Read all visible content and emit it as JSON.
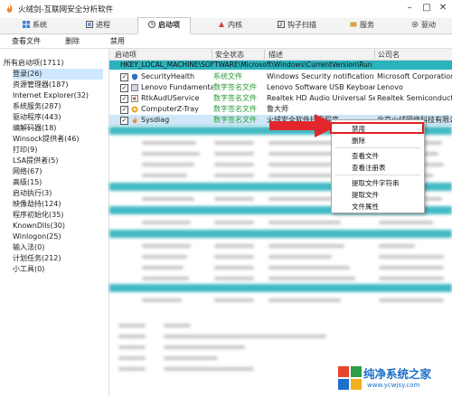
{
  "title": "火绒剑-互联网安全分析软件",
  "tabs": [
    {
      "label": "系统"
    },
    {
      "label": "进程"
    },
    {
      "label": "启动项"
    },
    {
      "label": "内核"
    },
    {
      "label": "钩子扫描"
    },
    {
      "label": "服务"
    },
    {
      "label": "驱动"
    }
  ],
  "toolbar": {
    "view_file": "查看文件",
    "delete": "删除",
    "disable": "禁用"
  },
  "sidebar": {
    "root": "所有启动项(1711)",
    "items": [
      "登录(26)",
      "资源管理器(187)",
      "Internet Explorer(32)",
      "系统服务(287)",
      "驱动程序(443)",
      "编解码器(18)",
      "Winsock提供者(46)",
      "打印(9)",
      "LSA提供者(5)",
      "网络(67)",
      "高级(15)",
      "启动执行(3)",
      "映像劫持(124)",
      "程序初始化(35)",
      "KnownDlls(30)",
      "Winlogon(25)",
      "输入法(0)",
      "计划任务(212)",
      "小工具(0)"
    ]
  },
  "columns": {
    "name": "启动项",
    "status": "安全状态",
    "desc": "描述",
    "company": "公司名"
  },
  "reg_path": "HKEY_LOCAL_MACHINE\\SOFTWARE\\Microsoft\\Windows\\CurrentVersion\\Run",
  "rows": [
    {
      "name": "SecurityHealth",
      "status": "系统文件",
      "desc": "Windows Security notification i...",
      "company": "Microsoft Corporation"
    },
    {
      "name": "Lenovo Fundamental ...",
      "status": "数字签名文件",
      "desc": "Lenovo Software USB Keyboard",
      "company": "Lenovo"
    },
    {
      "name": "RtkAudUService",
      "status": "数字签名文件",
      "desc": "Realtek HD Audio Universal Ser...",
      "company": "Realtek Semiconductor"
    },
    {
      "name": "ComputerZ-Tray",
      "status": "数字签名文件",
      "desc": "鲁大师",
      "company": ""
    },
    {
      "name": "Sysdiag",
      "status": "数字签名文件",
      "desc": "火绒安全软件托盘程序",
      "company": "北京火绒网络科技有限公司"
    }
  ],
  "context_menu": {
    "items": [
      "禁用",
      "删除",
      "查看文件",
      "查看注册表",
      "提取文件字符串",
      "提取文件",
      "文件属性"
    ]
  },
  "watermark": {
    "text": "纯净系统之家",
    "url": "www.ycwjsy.com"
  },
  "colors": {
    "accent": "#2bb3bd",
    "highlight": "#e02020",
    "status_green": "#2a9a3a"
  }
}
